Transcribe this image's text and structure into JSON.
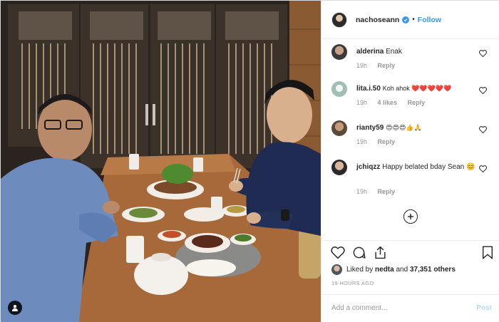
{
  "header": {
    "username": "nachoseann",
    "separator": "•",
    "follow_label": "Follow"
  },
  "comments": [
    {
      "user": "alderina",
      "text": "Enak",
      "time": "19h",
      "likes": "",
      "reply": "Reply"
    },
    {
      "user": "lita.i.50",
      "text": "Koh ahok ❤️❤️❤️❤️❤️",
      "time": "19h",
      "likes": "4 likes",
      "reply": "Reply"
    },
    {
      "user": "rianty59",
      "text": "😍😍😍👍🙏",
      "time": "19h",
      "likes": "",
      "reply": "Reply"
    },
    {
      "user": "jchiqzz",
      "text": "Happy belated bday Sean 😊",
      "time": "19h",
      "likes": "",
      "reply": "Reply"
    }
  ],
  "liked": {
    "prefix": "Liked by",
    "user": "nedta",
    "middle": "and",
    "count": "37,351 others"
  },
  "time_ago": "19 HOURS AGO",
  "add_comment": {
    "placeholder": "Add a comment...",
    "post_label": "Post"
  },
  "colors": {
    "link_blue": "#3897f0",
    "post_disabled": "#b2dffc",
    "heart_red": "#ed4956",
    "meta_gray": "#999999"
  },
  "icons": [
    "heart-icon",
    "comment-icon",
    "share-icon",
    "bookmark-icon",
    "plus-circle-icon",
    "user-tag-icon",
    "verified-badge-icon"
  ]
}
